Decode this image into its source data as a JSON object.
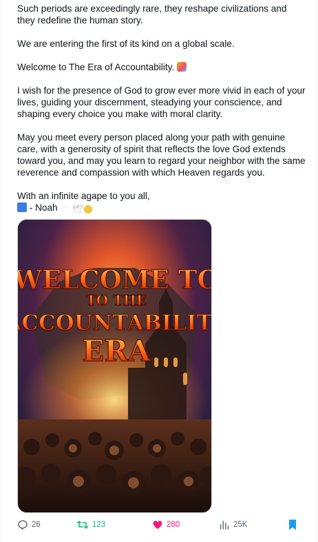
{
  "post": {
    "paragraphs": [
      "Such periods are exceedingly rare, they reshape civilizations and they redefine the human story.",
      "We are entering the first of its kind on a global scale.",
      "Welcome to The Era of Accountability.",
      "I wish for the presence of God to grow ever more vivid in each of your lives, guiding your discernment, steadying your conscience, and shaping every choice you make with moral clarity.",
      "May you meet every person placed along your path with genuine care, with a generosity of spirit that reflects the love God extends toward you, and may you learn to regard your neighbor with the same reverence and compassion with which Heaven regards you."
    ],
    "signoff_line": "With an infinite agape to you all,",
    "signature": " - Noah",
    "emojis": [
      "party-face-icon",
      "hand-icon",
      "white-heart-icon",
      "dove-icon",
      "face-icon"
    ]
  },
  "media": {
    "poster_line1": "WELCOME TO",
    "poster_line2": "TO THE",
    "poster_line3": "ACCOUNTABILITY",
    "poster_line4": "ERA"
  },
  "actions": {
    "replies": "26",
    "reposts": "123",
    "likes": "280",
    "views": "25K"
  },
  "colors": {
    "text": "#0f1419",
    "muted": "#536471",
    "repost_active": "#00ba7c",
    "like_active": "#f91880",
    "bookmark_active": "#1d9bf0"
  }
}
